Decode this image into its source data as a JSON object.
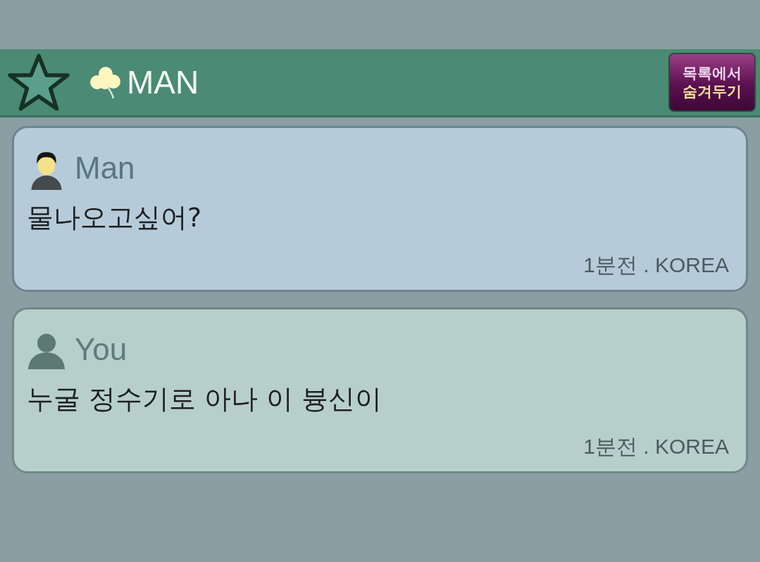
{
  "header": {
    "title": "MAN",
    "favorite": false,
    "hide_button": {
      "line_1": "목록에서",
      "line_2": "숨겨두기"
    }
  },
  "messages": [
    {
      "kind": "other",
      "sender": "Man",
      "text": "물나오고싶어?",
      "time": "1분전 . KOREA"
    },
    {
      "kind": "self",
      "sender": "You",
      "text": "누굴 정수기로 아나 이 븅신이",
      "time": "1분전 . KOREA"
    }
  ]
}
